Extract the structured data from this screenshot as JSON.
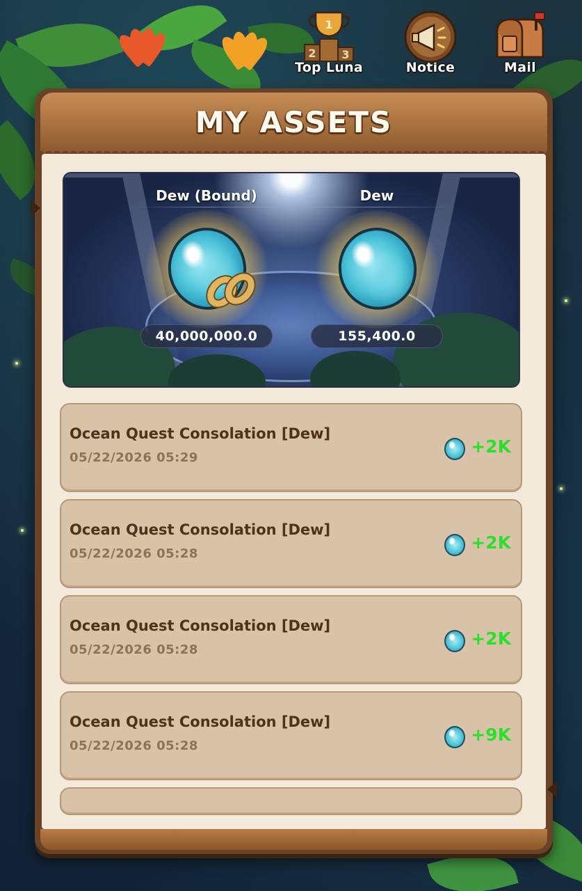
{
  "top_nav": {
    "top_luna": {
      "label": "Top Luna",
      "icon": "trophy-podium-icon"
    },
    "notice": {
      "label": "Notice",
      "icon": "megaphone-icon"
    },
    "mail": {
      "label": "Mail",
      "icon": "mailbox-icon"
    }
  },
  "panel": {
    "title": "MY ASSETS"
  },
  "assets": [
    {
      "label": "Dew (Bound)",
      "amount": "40,000,000.0",
      "icon": "dew-orb-chained-icon"
    },
    {
      "label": "Dew",
      "amount": "155,400.0",
      "icon": "dew-orb-icon"
    }
  ],
  "history": [
    {
      "title": "Ocean Quest Consolation [Dew]",
      "time": "05/22/2026 05:29",
      "amount": "+2K"
    },
    {
      "title": "Ocean Quest Consolation [Dew]",
      "time": "05/22/2026 05:28",
      "amount": "+2K"
    },
    {
      "title": "Ocean Quest Consolation [Dew]",
      "time": "05/22/2026 05:28",
      "amount": "+2K"
    },
    {
      "title": "Ocean Quest Consolation [Dew]",
      "time": "05/22/2026 05:28",
      "amount": "+9K"
    }
  ],
  "colors": {
    "gain": "#2ede2e",
    "panel_wood": "#6a4226",
    "parchment": "#f3eadb",
    "row_bg": "#d8c3a8"
  }
}
